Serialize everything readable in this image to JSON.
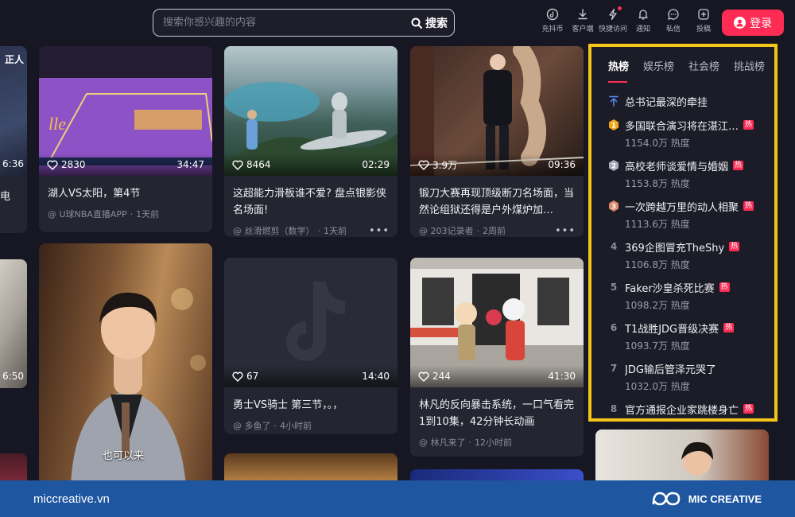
{
  "search": {
    "placeholder": "搜索你感兴趣的内容",
    "button_label": "搜索"
  },
  "nav": [
    {
      "label": "充抖币",
      "icon": "coin-icon"
    },
    {
      "label": "客户端",
      "icon": "download-icon"
    },
    {
      "label": "快捷访问",
      "icon": "lightning-icon"
    },
    {
      "label": "通知",
      "icon": "bell-icon"
    },
    {
      "label": "私信",
      "icon": "message-icon"
    },
    {
      "label": "投稿",
      "icon": "upload-icon"
    }
  ],
  "login_label": "登录",
  "left_partial": {
    "top_label": "正人",
    "duration_1": "6:36",
    "title_1": "电",
    "duration_2": "6:50"
  },
  "cards": [
    {
      "likes": "2830",
      "duration": "34:47",
      "title": "湖人VS太阳，第4节",
      "author": "@ U球NBA直播APP",
      "time": "1天前"
    },
    {
      "likes": "8464",
      "duration": "02:29",
      "title": "这超能力滑板谁不爱? 盘点银影侠名场面!",
      "author": "@ 丝滑燃剪（数学）",
      "time": "1天前"
    },
    {
      "likes": "3.9万",
      "duration": "09:36",
      "title": "锻刀大赛再现顶级断刀名场面，当然论组狱还得是户外煤炉加…",
      "author": "@ 203记录者",
      "time": "2周前"
    },
    {
      "caption": "也可以来"
    },
    {
      "likes": "67",
      "duration": "14:40",
      "title": "勇士VS骑士 第三节，。，",
      "author": "@ 多鱼了",
      "time": "4小时前"
    },
    {
      "likes": "244",
      "duration": "41:30",
      "title": "林凡的反向暴击系统，一口气看完1到10集，42分钟长动画",
      "author": "@ 林凡来了",
      "time": "12小时前"
    }
  ],
  "trending": {
    "tabs": [
      "热榜",
      "娱乐榜",
      "社会榜",
      "挑战榜"
    ],
    "hot_badge": "热",
    "items": [
      {
        "rank": "",
        "title": "总书记最深的牵挂",
        "heat": ""
      },
      {
        "rank": "1",
        "title": "多国联合演习将在湛江…",
        "heat": "1154.0万 热度"
      },
      {
        "rank": "2",
        "title": "高校老师谈爱情与婚姻",
        "heat": "1153.8万 热度"
      },
      {
        "rank": "3",
        "title": "一次跨越万里的动人相聚",
        "heat": "1113.6万 热度"
      },
      {
        "rank": "4",
        "title": "369企图冒充TheShy",
        "heat": "1106.8万 热度"
      },
      {
        "rank": "5",
        "title": "Faker沙皇杀死比赛",
        "heat": "1098.2万 热度"
      },
      {
        "rank": "6",
        "title": "T1战胜JDG晋级决赛",
        "heat": "1093.7万 热度"
      },
      {
        "rank": "7",
        "title": "JDG输后管泽元哭了",
        "heat": "1032.0万 热度"
      },
      {
        "rank": "8",
        "title": "官方通报企业家跳楼身亡",
        "heat": ""
      }
    ]
  },
  "footer": {
    "site": "miccreative.vn",
    "brand": "MIC CREATIVE"
  },
  "colors": {
    "accent": "#fe2c55",
    "panel_border": "#f5c518",
    "footer_bg": "#1e56a0"
  }
}
